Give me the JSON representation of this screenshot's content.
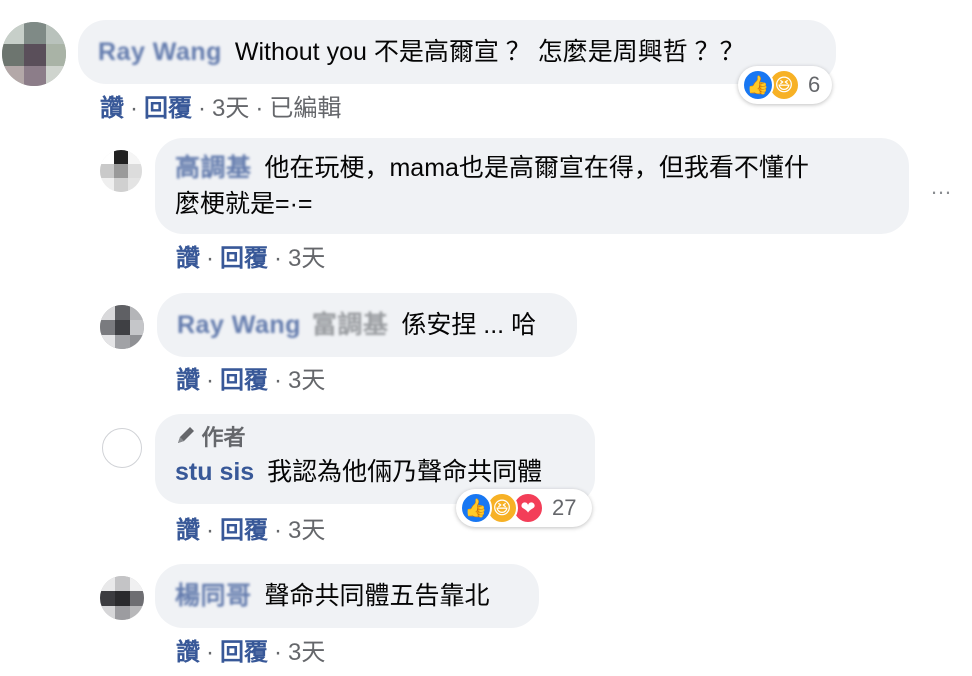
{
  "comments": [
    {
      "author": "Ray Wang",
      "text": "Without you 不是高爾宣 ？ 怎麼是周興哲 ？？",
      "actions": {
        "like": "讚",
        "reply": "回覆",
        "time": "3天",
        "edited": "已編輯"
      },
      "reactions": {
        "types": [
          "like",
          "haha"
        ],
        "count": "6"
      }
    },
    {
      "author": "高調基",
      "text_line1": "他在玩梗，mama也是高爾宣在得，但我看不懂什",
      "text_line2": "麼梗就是=·=",
      "actions": {
        "like": "讚",
        "reply": "回覆",
        "time": "3天"
      }
    },
    {
      "author": "Ray Wang",
      "mention": "富調基",
      "text": "係安捏 ... 哈",
      "actions": {
        "like": "讚",
        "reply": "回覆",
        "time": "3天"
      }
    },
    {
      "author_badge": "作者",
      "author": "stu sis",
      "text": "我認為他倆乃聲命共同體",
      "actions": {
        "like": "讚",
        "reply": "回覆",
        "time": "3天"
      },
      "reactions": {
        "types": [
          "like",
          "haha",
          "love"
        ],
        "count": "27"
      }
    },
    {
      "author": "楊同哥",
      "text": "聲命共同體五告靠北",
      "actions": {
        "like": "讚",
        "reply": "回覆",
        "time": "3天"
      }
    }
  ],
  "separator": "·",
  "more_icon": "…",
  "colors": {
    "link": "#385898",
    "bubble": "#f0f2f5",
    "meta": "#65676b",
    "like": "#1877f2",
    "haha": "#f7b125",
    "love": "#f33e58"
  }
}
